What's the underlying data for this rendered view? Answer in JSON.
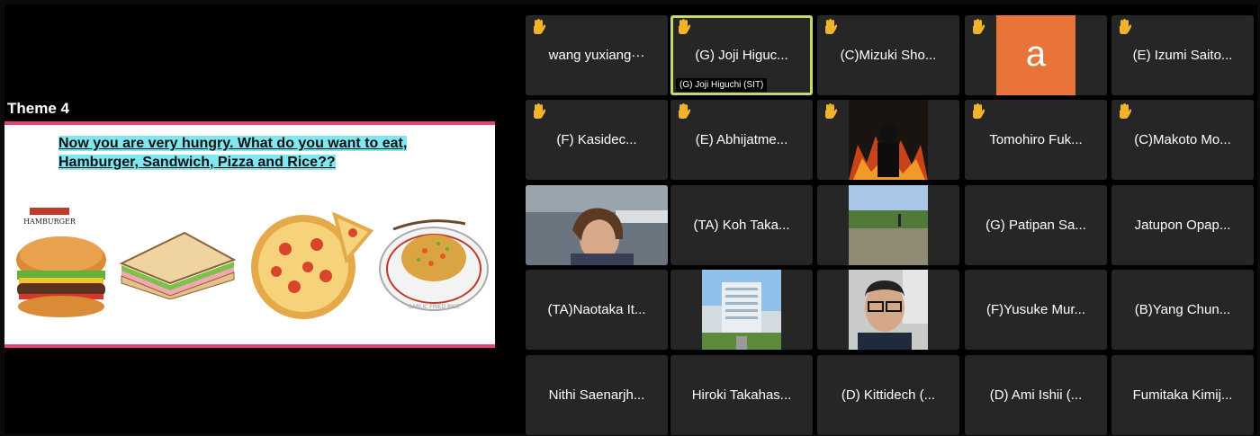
{
  "share": {
    "title": "Theme 4",
    "question_line1": "Now you are very hungry. What do you want to eat,",
    "question_line2": "Hamburger, Sandwich, Pizza and Rice??",
    "hamburger_banner": "HAMBURGER",
    "rice_plate_text": "GARLIC FRIED RICE"
  },
  "tiles": [
    {
      "name": "wang yuxiang···",
      "hand": true
    },
    {
      "name": "(G) Joji Higuc...",
      "hand": true,
      "active": true,
      "badge": "(G) Joji Higuchi (SIT)"
    },
    {
      "name": "(C)Mizuki Sho...",
      "hand": true
    },
    {
      "name": "",
      "hand": true,
      "avatar": "a"
    },
    {
      "name": "(E) Izumi Saito...",
      "hand": true
    },
    {
      "name": "(F)  Kasidec...",
      "hand": true
    },
    {
      "name": "(E)  Abhijatme...",
      "hand": true
    },
    {
      "name": "",
      "hand": true,
      "video": "dark-fire"
    },
    {
      "name": "Tomohiro Fuk...",
      "hand": true
    },
    {
      "name": "(C)Makoto Mo...",
      "hand": true
    },
    {
      "name": "",
      "video": "woman-camera"
    },
    {
      "name": "(TA) Koh Taka..."
    },
    {
      "name": "",
      "video": "field-photo"
    },
    {
      "name": "(G) Patipan Sa..."
    },
    {
      "name": "Jatupon Opap..."
    },
    {
      "name": "(TA)Naotaka It..."
    },
    {
      "name": "",
      "video": "building-photo"
    },
    {
      "name": "",
      "video": "man-camera"
    },
    {
      "name": "(F)Yusuke Mur..."
    },
    {
      "name": "(B)Yang Chun..."
    },
    {
      "name": "Nithi Saenarjh..."
    },
    {
      "name": "Hiroki Takahas..."
    },
    {
      "name": "(D) Kittidech (..."
    },
    {
      "name": "(D) Ami Ishii (..."
    },
    {
      "name": "Fumitaka Kimij..."
    }
  ],
  "colors": {
    "hand": "#f0b32a",
    "avatar": "#e8743a",
    "active_border": "#c8d86a",
    "highlight": "#7fe7f0",
    "accent_pink": "#e0447a"
  }
}
